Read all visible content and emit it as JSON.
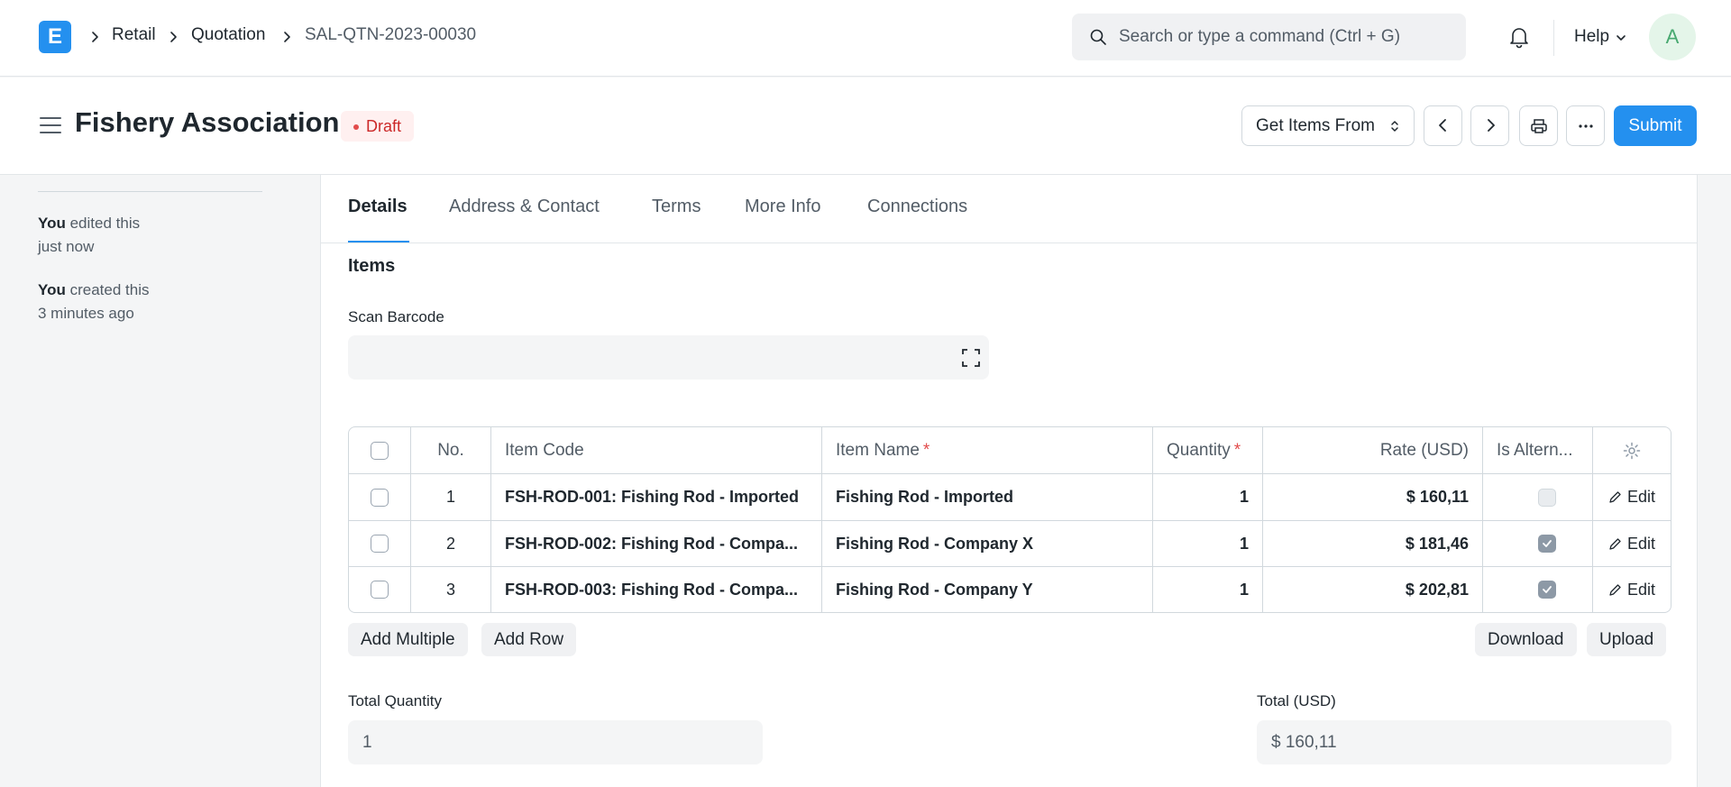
{
  "nav": {
    "logo": "E",
    "breadcrumbs": [
      "Retail",
      "Quotation",
      "SAL-QTN-2023-00030"
    ],
    "search_placeholder": "Search or type a command (Ctrl + G)",
    "help_label": "Help",
    "avatar_initial": "A"
  },
  "page": {
    "title": "Fishery Association",
    "status": "Draft",
    "get_items_label": "Get Items From",
    "submit_label": "Submit"
  },
  "sidebar": {
    "activity": [
      {
        "actor": "You",
        "action": "edited this",
        "time": "just now"
      },
      {
        "actor": "You",
        "action": "created this",
        "time": "3 minutes ago"
      }
    ]
  },
  "tabs": [
    "Details",
    "Address & Contact",
    "Terms",
    "More Info",
    "Connections"
  ],
  "items_section": {
    "title": "Items",
    "scan_barcode_label": "Scan Barcode",
    "scan_barcode_value": ""
  },
  "grid": {
    "columns": {
      "no": "No.",
      "item_code": "Item Code",
      "item_name": "Item Name",
      "quantity": "Quantity",
      "rate": "Rate (USD)",
      "is_alternative": "Is Altern..."
    },
    "rows": [
      {
        "no": "1",
        "item_code": "FSH-ROD-001: Fishing Rod - Imported",
        "item_name": "Fishing Rod - Imported",
        "quantity": "1",
        "rate": "$ 160,11",
        "is_alternative": false,
        "edit": "Edit"
      },
      {
        "no": "2",
        "item_code": "FSH-ROD-002: Fishing Rod - Compa...",
        "item_name": "Fishing Rod - Company X",
        "quantity": "1",
        "rate": "$ 181,46",
        "is_alternative": true,
        "edit": "Edit"
      },
      {
        "no": "3",
        "item_code": "FSH-ROD-003: Fishing Rod - Compa...",
        "item_name": "Fishing Rod - Company Y",
        "quantity": "1",
        "rate": "$ 202,81",
        "is_alternative": true,
        "edit": "Edit"
      }
    ],
    "add_multiple_label": "Add Multiple",
    "add_row_label": "Add Row",
    "download_label": "Download",
    "upload_label": "Upload"
  },
  "totals": {
    "total_quantity_label": "Total Quantity",
    "total_quantity_value": "1",
    "total_label": "Total (USD)",
    "total_value": "$ 160,11"
  },
  "colors": {
    "primary": "#2490ef",
    "draft_bg": "#fff0f0",
    "draft_text": "#cc2929"
  }
}
